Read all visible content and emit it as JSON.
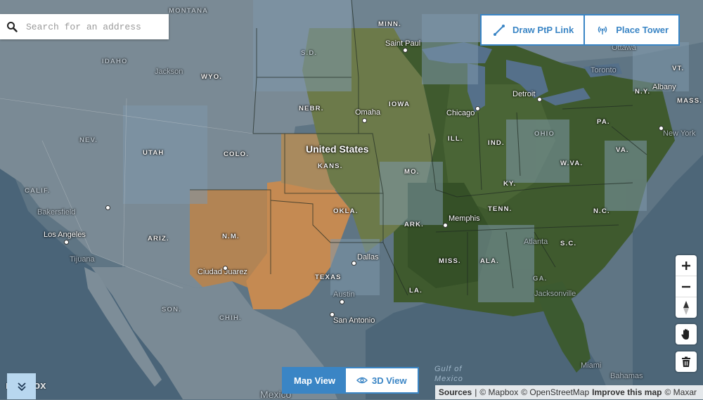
{
  "search": {
    "placeholder": "Search for an address"
  },
  "toolbar": {
    "draw_ptp_label": "Draw PtP Link",
    "place_tower_label": "Place Tower"
  },
  "map": {
    "country": "United States",
    "states": [
      "MONTANA",
      "IDAHO",
      "WYO.",
      "NEBR.",
      "MINN.",
      "IOWA",
      "ILL.",
      "IND.",
      "OHIO",
      "PA.",
      "N.Y.",
      "VT.",
      "MASS.",
      "NEV.",
      "UTAH",
      "COLO.",
      "KANS.",
      "MO.",
      "KY.",
      "W.VA.",
      "VA.",
      "CALIF.",
      "ARIZ.",
      "N.M.",
      "OKLA.",
      "ARK.",
      "TENN.",
      "N.C.",
      "S.C.",
      "MISS.",
      "ALA.",
      "TEXAS",
      "LA.",
      "GA.",
      "S.D.",
      "SON.",
      "CHIH."
    ],
    "cities": [
      "Jackson",
      "Saint Paul",
      "Omaha",
      "Chicago",
      "Detroit",
      "Toronto",
      "Albany",
      "New York",
      "Ottawa",
      "Bakersfield",
      "Los Angeles",
      "Tijuana",
      "Memphis",
      "Atlanta",
      "Dallas",
      "Ciudad Juarez",
      "Austin",
      "San Antonio",
      "Jacksonville",
      "Miami",
      "Bahamas",
      "Mexico"
    ],
    "water": [
      "Gulf of",
      "Mexico"
    ]
  },
  "view_toggle": {
    "map_view": "Map View",
    "view_3d": "3D View"
  },
  "logo": "mapbox",
  "attribution": {
    "sources": "Sources",
    "mapbox": "© Mapbox",
    "osm": "© OpenStreetMap",
    "improve": "Improve this map",
    "maxar": "© Maxar"
  },
  "colors": {
    "accent": "#3a85c5"
  }
}
